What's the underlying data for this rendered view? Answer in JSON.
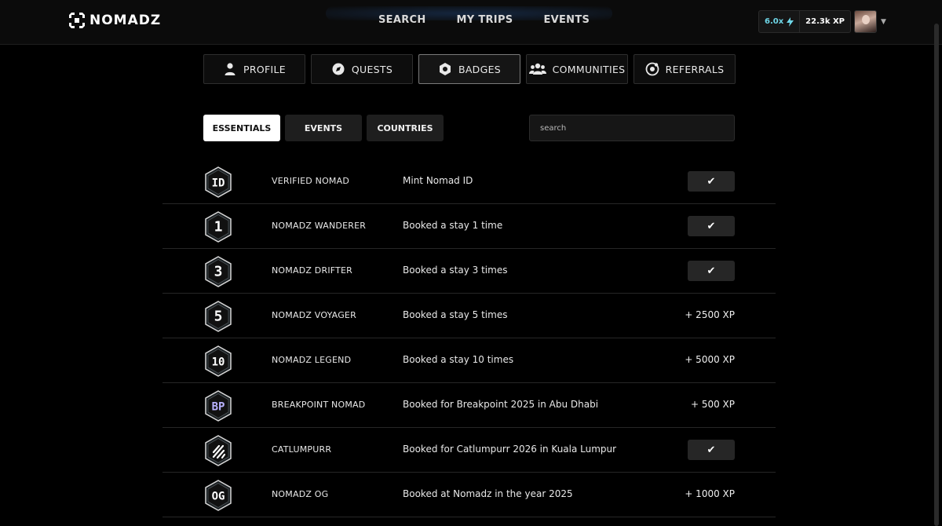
{
  "header": {
    "logo_text": "NOMADZ",
    "nav": [
      "SEARCH",
      "MY TRIPS",
      "EVENTS"
    ],
    "multiplier": "6.0x",
    "xp": "22.3k XP"
  },
  "main_tabs": [
    "PROFILE",
    "QUESTS",
    "BADGES",
    "COMMUNITIES",
    "REFERRALS"
  ],
  "active_main_tab": "BADGES",
  "sub_tabs": [
    "ESSENTIALS",
    "EVENTS",
    "COUNTRIES"
  ],
  "active_sub_tab": "ESSENTIALS",
  "search": {
    "placeholder": "search"
  },
  "badges": [
    {
      "icon_label": "ID",
      "name": "VERIFIED NOMAD",
      "description": "Mint Nomad ID",
      "status": "claimed",
      "reward": ""
    },
    {
      "icon_label": "1",
      "name": "NOMADZ WANDERER",
      "description": "Booked a stay 1 time",
      "status": "claimed",
      "reward": ""
    },
    {
      "icon_label": "3",
      "name": "NOMADZ DRIFTER",
      "description": "Booked a stay 3 times",
      "status": "claimed",
      "reward": ""
    },
    {
      "icon_label": "5",
      "name": "NOMADZ VOYAGER",
      "description": "Booked a stay 5 times",
      "status": "reward",
      "reward": "+ 2500 XP"
    },
    {
      "icon_label": "10",
      "name": "NOMADZ LEGEND",
      "description": "Booked a stay 10 times",
      "status": "reward",
      "reward": "+ 5000 XP"
    },
    {
      "icon_label": "BP",
      "name": "BREAKPOINT NOMAD",
      "description": "Booked for Breakpoint 2025 in Abu Dhabi",
      "status": "reward",
      "reward": "+ 500 XP"
    },
    {
      "icon_label": "",
      "name": "CATLUMPURR",
      "description": "Booked for Catlumpurr 2026 in Kuala Lumpur",
      "status": "claimed",
      "reward": ""
    },
    {
      "icon_label": "OG",
      "name": "NOMADZ OG",
      "description": "Booked at Nomadz in the year 2025",
      "status": "reward",
      "reward": "+ 1000 XP"
    }
  ],
  "colors": {
    "accent_cyan": "#6fd7e8",
    "badge_bp": "#b9b2ff",
    "badge_default": "#ffffff"
  }
}
